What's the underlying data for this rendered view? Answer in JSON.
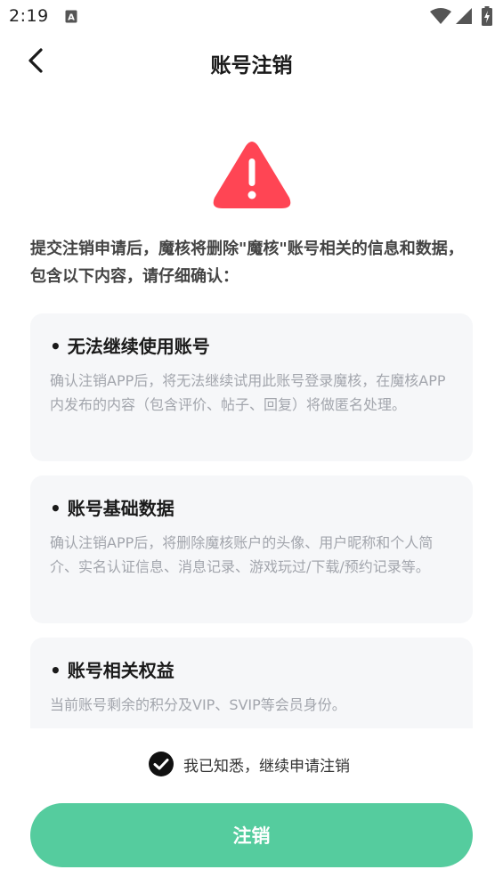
{
  "status_bar": {
    "time": "2:19",
    "icons": [
      "a-icon",
      "wifi-icon",
      "signal-icon",
      "battery-charging-icon"
    ]
  },
  "header": {
    "back_icon": "chevron-left-icon",
    "title": "账号注销"
  },
  "warning": {
    "icon": "warning-triangle-icon",
    "color": "#ff4554"
  },
  "intro": "提交注销申请后，魔核将删除\"魔核\"账号相关的信息和数据，包含以下内容，请仔细确认：",
  "cards": [
    {
      "title": "• 无法继续使用账号",
      "desc": "确认注销APP后，将无法继续试用此账号登录魔核，在魔核APP内发布的内容（包含评价、帖子、回复）将做匿名处理。"
    },
    {
      "title": "• 账号基础数据",
      "desc": "确认注销APP后，将删除魔核账户的头像、用户昵称和个人简介、实名认证信息、消息记录、游戏玩过/下载/预约记录等。"
    },
    {
      "title": "• 账号相关权益",
      "desc": "当前账号剩余的积分及VIP、SVIP等会员身份。"
    }
  ],
  "agreement": {
    "checked": true,
    "label": "我已知悉，继续申请注销"
  },
  "submit": {
    "label": "注销",
    "color": "#55cc9e"
  }
}
